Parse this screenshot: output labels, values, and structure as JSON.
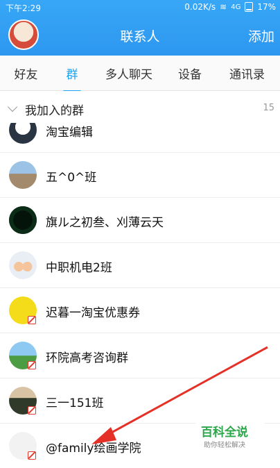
{
  "status_bar": {
    "time": "下午2:29",
    "speed": "0.02K/s",
    "network": "4G",
    "battery": "17%"
  },
  "header": {
    "title": "联系人",
    "add_label": "添加"
  },
  "tabs": [
    {
      "label": "好友",
      "active": false
    },
    {
      "label": "群",
      "active": true
    },
    {
      "label": "多人聊天",
      "active": false
    },
    {
      "label": "设备",
      "active": false
    },
    {
      "label": "通讯录",
      "active": false
    }
  ],
  "section": {
    "label": "我加入的群",
    "count": "15"
  },
  "groups": [
    {
      "name": "淘宝编辑"
    },
    {
      "name": "五^0^班"
    },
    {
      "name": "旗ル之初叁、刈薄云天"
    },
    {
      "name": "中职机电2班"
    },
    {
      "name": "迟暮一淘宝优惠券"
    },
    {
      "name": "环院高考咨询群"
    },
    {
      "name": "三一151班"
    },
    {
      "name": "@family绘画学院"
    }
  ],
  "watermark": {
    "title": "百科全说",
    "subtitle": "助你轻松解决"
  },
  "colors": {
    "header": "#2d97f0",
    "active_tab": "#1ea4f5",
    "arrow": "#e53027"
  }
}
